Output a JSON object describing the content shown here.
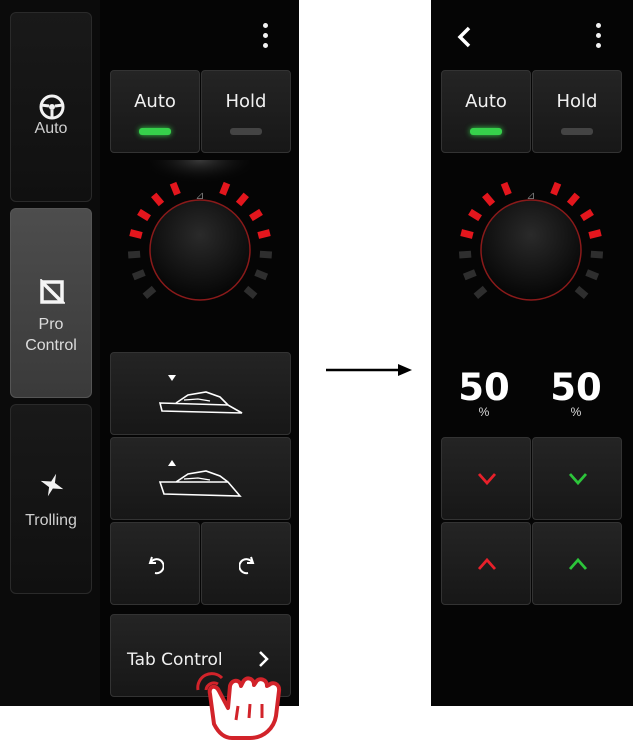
{
  "left_screen": {
    "sidebar": {
      "items": [
        {
          "label": "Auto",
          "icon": "steering-wheel-icon"
        },
        {
          "label": "Pro Control",
          "label_line1": "Pro",
          "label_line2": "Control",
          "icon": "pro-control-icon",
          "selected": true
        },
        {
          "label": "Trolling",
          "icon": "trolling-icon"
        }
      ]
    },
    "modes": [
      {
        "label": "Auto",
        "indicator": "green"
      },
      {
        "label": "Hold",
        "indicator": "grey"
      }
    ],
    "controls": {
      "bow_up_icon": "boat-bow-down-icon",
      "bow_down_icon": "boat-bow-up-icon",
      "rotate_left_icon": "rotate-ccw-icon",
      "rotate_right_icon": "rotate-cw-icon"
    },
    "tab_control": {
      "label": "Tab Control",
      "icon": "chevron-right-icon"
    },
    "menu_icon": "kebab-menu-icon"
  },
  "right_screen": {
    "back_icon": "chevron-left-icon",
    "menu_icon": "kebab-menu-icon",
    "modes": [
      {
        "label": "Auto",
        "indicator": "green"
      },
      {
        "label": "Hold",
        "indicator": "grey"
      }
    ],
    "left_tab": {
      "value": "50",
      "unit": "%",
      "color": "#e8202a"
    },
    "right_tab": {
      "value": "50",
      "unit": "%",
      "color": "#2cc53a"
    }
  },
  "colors": {
    "led_green": "#36d14b",
    "led_grey": "#444444",
    "dial_red": "#e3161d",
    "dial_dark": "#2e2e2e",
    "tap_hand": "#d2232a"
  }
}
